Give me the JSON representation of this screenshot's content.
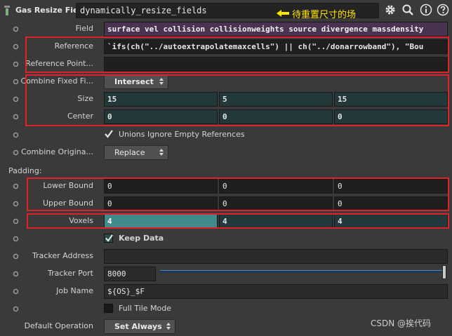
{
  "header": {
    "node_type": "Gas Resize Field",
    "node_name": "dynamically_resize_fields",
    "annotation": "待重置尺寸的场",
    "icons": [
      "gear-icon",
      "search-icon",
      "info-icon",
      "help-icon"
    ]
  },
  "params": {
    "field": {
      "label": "Field",
      "value": "surface vel collision collisionweights source divergence massdensity"
    },
    "reference": {
      "label": "Reference",
      "value": "`ifs(ch(\"../autoextrapolatemaxcells\") || ch(\"../donarrowband\"), \"Bou"
    },
    "reference_point": {
      "label": "Reference Point...",
      "value": ""
    },
    "combine_fixed": {
      "label": "Combine Fixed Fi...",
      "value": "Intersect"
    },
    "size": {
      "label": "Size",
      "values": [
        "15",
        "5",
        "15"
      ]
    },
    "center": {
      "label": "Center",
      "values": [
        "0",
        "0",
        "0"
      ]
    },
    "unions_ignore": {
      "label": "Unions Ignore Empty References",
      "checked": true
    },
    "combine_original": {
      "label": "Combine Origina...",
      "value": "Replace"
    },
    "padding_section": "Padding:",
    "lower_bound": {
      "label": "Lower Bound",
      "values": [
        "0",
        "0",
        "0"
      ]
    },
    "upper_bound": {
      "label": "Upper Bound",
      "values": [
        "0",
        "0",
        "0"
      ]
    },
    "voxels": {
      "label": "Voxels",
      "values": [
        "4",
        "4",
        "4"
      ]
    },
    "keep_data": {
      "label": "Keep Data",
      "checked": true
    },
    "tracker_address": {
      "label": "Tracker Address",
      "value": ""
    },
    "tracker_port": {
      "label": "Tracker Port",
      "value": "8000"
    },
    "job_name": {
      "label": "Job Name",
      "value": "${OS}_$F"
    },
    "full_tile_mode": {
      "label": "Full Tile Mode",
      "checked": false
    },
    "default_operation": {
      "label": "Default Operation",
      "value": "Set Always"
    }
  },
  "watermark": "CSDN @挨代码",
  "colors": {
    "highlight_box": "#e0222a",
    "annotation": "#ffe400",
    "field_purple": "#4a3350",
    "voxel_teal": "#3f8a8a"
  }
}
